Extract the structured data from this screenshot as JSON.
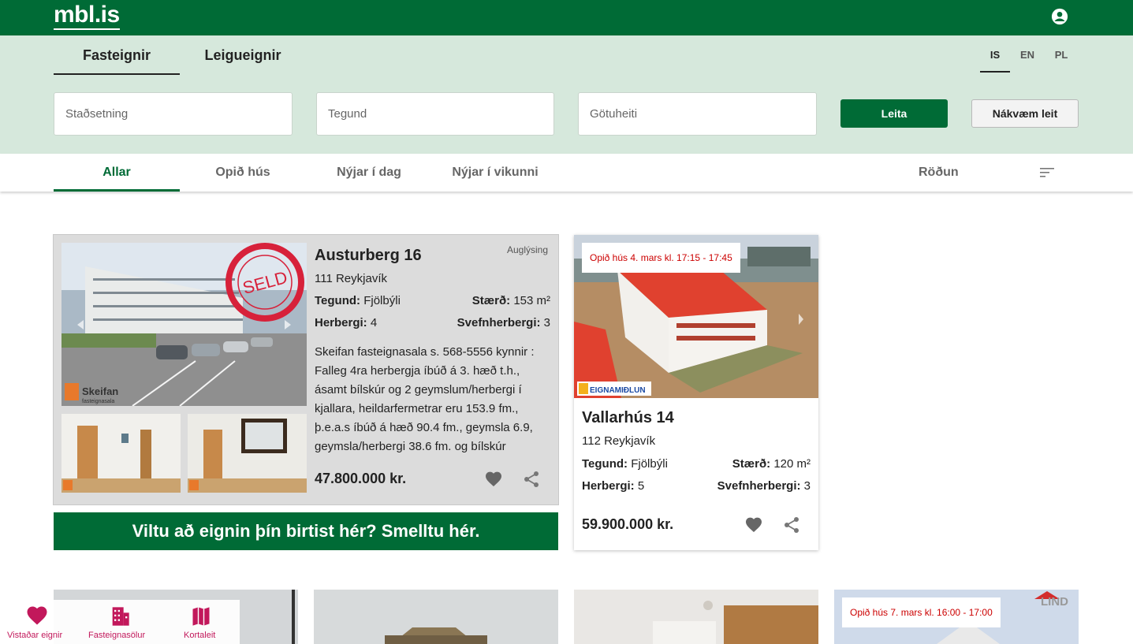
{
  "header": {
    "logo": "mbl.is",
    "account_icon": "account-circle-icon"
  },
  "main_tabs": [
    {
      "label": "Fasteignir",
      "active": true
    },
    {
      "label": "Leigueignir",
      "active": false
    }
  ],
  "languages": [
    {
      "label": "IS",
      "active": true
    },
    {
      "label": "EN",
      "active": false
    },
    {
      "label": "PL",
      "active": false
    }
  ],
  "search": {
    "location_placeholder": "Staðsetning",
    "type_placeholder": "Tegund",
    "street_placeholder": "Götuheiti",
    "search_button": "Leita",
    "advanced_button": "Nákvæm leit"
  },
  "filters": {
    "tabs": [
      {
        "label": "Allar",
        "active": true
      },
      {
        "label": "Opið hús",
        "active": false
      },
      {
        "label": "Nýjar í dag",
        "active": false
      },
      {
        "label": "Nýjar í vikunni",
        "active": false
      }
    ],
    "sort_label": "Röðun"
  },
  "featured": {
    "title": "Austurberg 16",
    "ad_label": "Auglýsing",
    "city": "111 Reykjavík",
    "type_label": "Tegund:",
    "type_value": "Fjölbýli",
    "size_label": "Stærð:",
    "size_value": "153 m²",
    "rooms_label": "Herbergi:",
    "rooms_value": "4",
    "bedrooms_label": "Svefnherbergi:",
    "bedrooms_value": "3",
    "description": "Skeifan fasteignasala s. 568-5556 kynnir : Falleg 4ra herbergja íbúð á 3. hæð t.h., ásamt bílskúr og 2 geymslum/herbergi í kjallara, heildarfermetrar eru 153.9 fm., þ.e.a.s íbúð á hæð 90.4 fm., geymsla 6.9, geymsla/herbergi 38.6 fm. og bílskúr",
    "price": "47.800.000 kr.",
    "sold_stamp": "SELD",
    "agency": "Skeifan",
    "agency_sub": "fasteignasala"
  },
  "cta": "Viltu að eignin þín birtist hér? Smelltu hér.",
  "card": {
    "open_house": "Opið hús 4. mars kl. 17:15 - 17:45",
    "agency": "EIGNAMIÐLUN",
    "title": "Vallarhús 14",
    "city": "112 Reykjavík",
    "type_label": "Tegund:",
    "type_value": "Fjölbýli",
    "size_label": "Stærð:",
    "size_value": "120 m²",
    "rooms_label": "Herbergi:",
    "rooms_value": "5",
    "bedrooms_label": "Svefnherbergi:",
    "bedrooms_value": "3",
    "price": "59.900.000 kr."
  },
  "bottom_row": {
    "open_house_4": "Opið hús 7. mars kl. 16:00 - 17:00",
    "agency_4": "LIND"
  },
  "floatnav": [
    {
      "label": "Vistaðar eignir",
      "icon": "heart-icon"
    },
    {
      "label": "Fasteignasölur",
      "icon": "building-icon"
    },
    {
      "label": "Kortaleit",
      "icon": "map-icon"
    }
  ],
  "colors": {
    "brand": "#006b36",
    "search_bg": "#d6e8dc",
    "accent_pink": "#c2185b",
    "open_house_red": "#cc0000"
  }
}
